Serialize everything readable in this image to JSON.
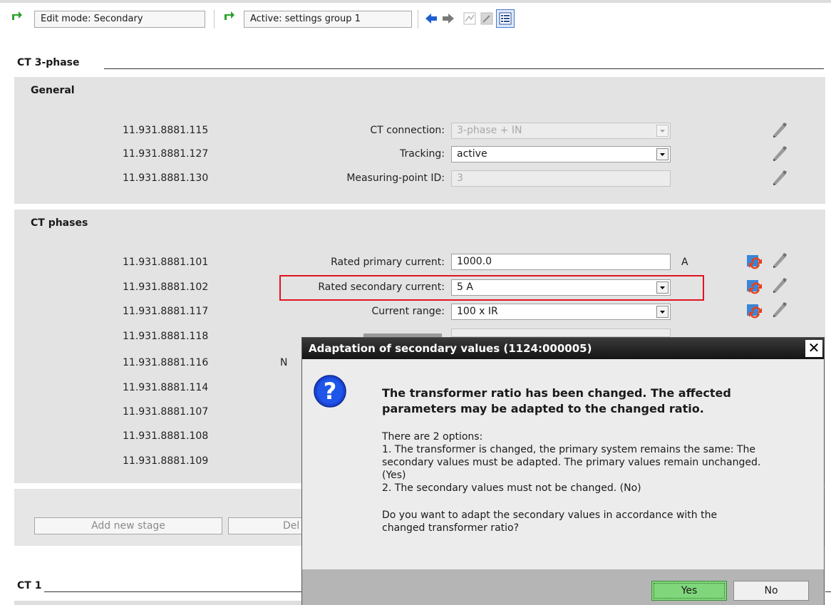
{
  "toolbar": {
    "edit_mode": "Edit mode: Secondary",
    "active_group": "Active: settings group 1"
  },
  "ct3phase": {
    "title": "CT 3-phase"
  },
  "general": {
    "title": "General",
    "rows": [
      {
        "id": "11.931.8881.115",
        "label": "CT connection:",
        "value": "3-phase + IN"
      },
      {
        "id": "11.931.8881.127",
        "label": "Tracking:",
        "value": "active"
      },
      {
        "id": "11.931.8881.130",
        "label": "Measuring-point ID:",
        "value": "3"
      }
    ]
  },
  "ctphases": {
    "title": "CT phases",
    "rows": [
      {
        "id": "11.931.8881.101",
        "label": "Rated primary current:",
        "value": "1000.0",
        "unit": "A"
      },
      {
        "id": "11.931.8881.102",
        "label": "Rated secondary current:",
        "value": "5 A"
      },
      {
        "id": "11.931.8881.117",
        "label": "Current range:",
        "value": "100 x IR"
      },
      {
        "id": "11.931.8881.118"
      },
      {
        "id": "11.931.8881.116",
        "label_fragment": "N"
      },
      {
        "id": "11.931.8881.114"
      },
      {
        "id": "11.931.8881.107"
      },
      {
        "id": "11.931.8881.108"
      },
      {
        "id": "11.931.8881.109"
      }
    ]
  },
  "stage_buttons": {
    "add": "Add new stage",
    "delete_fragment": "Del"
  },
  "ct1": {
    "title": "CT 1"
  },
  "dialog": {
    "title": "Adaptation of secondary values  (1124:000005)",
    "close": "✕",
    "main_1": "The transformer ratio has been changed. The affected",
    "main_2": "parameters may be adapted to the changed ratio.",
    "t1": "There are 2 options:",
    "t2": "1. The transformer is changed, the primary system remains the same: The",
    "t3": "secondary values must be adapted. The primary values remain unchanged.",
    "t4": "(Yes)",
    "t5": "2. The secondary values must not be changed. (No)",
    "t6": "Do you want to adapt the secondary values in accordance with the",
    "t7": "changed transformer ratio?",
    "yes": "Yes",
    "no": "No"
  },
  "colors": {
    "accent_red": "#e0141e",
    "yes_green": "#7fd67b",
    "dialog_title_bg": "#1f1f1f"
  }
}
